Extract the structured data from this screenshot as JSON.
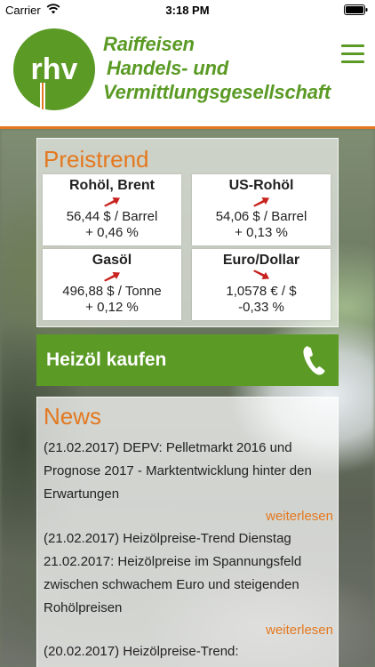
{
  "status_bar": {
    "carrier": "Carrier",
    "time": "3:18 PM",
    "icons": [
      "wifi-icon",
      "battery-icon"
    ]
  },
  "header": {
    "logo_text": "rhv",
    "company_line1": "Raiffeisen",
    "company_line2": "Handels- und",
    "company_line3": "Vermittlungsgesellschaft",
    "menu_icon": "hamburger-menu-icon"
  },
  "colors": {
    "brand_green": "#5a9a25",
    "accent_orange": "#e4781f",
    "arrow_red": "#c8221e"
  },
  "preistrend": {
    "title": "Preistrend",
    "tiles": [
      {
        "name": "Rohöl, Brent",
        "value": "56,44 $ / Barrel",
        "change": "+ 0,46 %",
        "trend_icon": "arrow-up-right-icon"
      },
      {
        "name": "US-Rohöl",
        "value": "54,06 $ / Barrel",
        "change": "+ 0,13 %",
        "trend_icon": "arrow-up-right-icon"
      },
      {
        "name": "Gasöl",
        "value": "496,88 $ / Tonne",
        "change": "+ 0,12 %",
        "trend_icon": "arrow-up-right-icon"
      },
      {
        "name": "Euro/Dollar",
        "value": "1,0578 € / $",
        "change": "-0,33 %",
        "trend_icon": "arrow-down-right-icon"
      }
    ]
  },
  "buy_button": {
    "label": "Heizöl kaufen",
    "icon": "phone-icon"
  },
  "news": {
    "title": "News",
    "read_more_label": "weiterlesen",
    "items": [
      {
        "text": "(21.02.2017) DEPV: Pelletmarkt 2016 und Prognose 2017 - Marktentwicklung hinter den Erwartungen"
      },
      {
        "text": "(21.02.2017) Heizölpreise-Trend Dienstag 21.02.2017: Heizölpreise im Spannungsfeld zwischen schwachem Euro und steigenden Rohölpreisen"
      },
      {
        "text": "(20.02.2017) Heizölpreise-Trend:"
      }
    ]
  }
}
